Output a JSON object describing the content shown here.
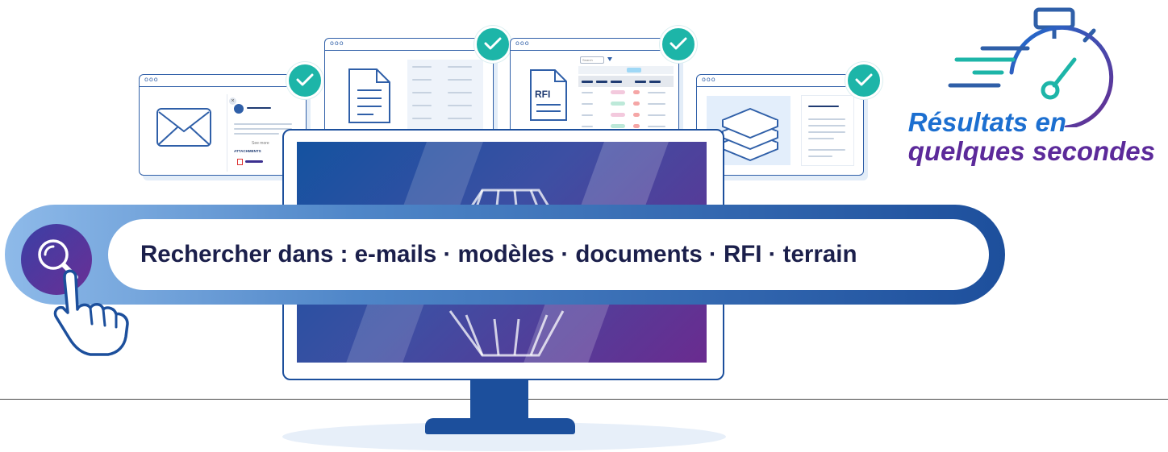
{
  "search": {
    "label": "Rechercher dans : e-mails · modèles · documents · RFI · terrain"
  },
  "tagline": {
    "line1": "Résultats en",
    "line2": "quelques secondes"
  },
  "windows": {
    "dots": "ooo",
    "email": {
      "see_more": "See more",
      "attachments": "ATTACHMENTS"
    },
    "rfi": {
      "badge": "RFI",
      "search_placeholder": "Search"
    }
  },
  "icons": [
    "envelope-icon",
    "document-icon",
    "rfi-document-icon",
    "layers-icon",
    "check-icon",
    "search-icon",
    "pointer-hand-icon",
    "stopwatch-icon"
  ],
  "colors": {
    "navy": "#1c4f9c",
    "teal": "#1db5a8",
    "purple": "#6a2b8f",
    "blue_text": "#1c6fd0",
    "dark_text": "#1b1f4b"
  }
}
